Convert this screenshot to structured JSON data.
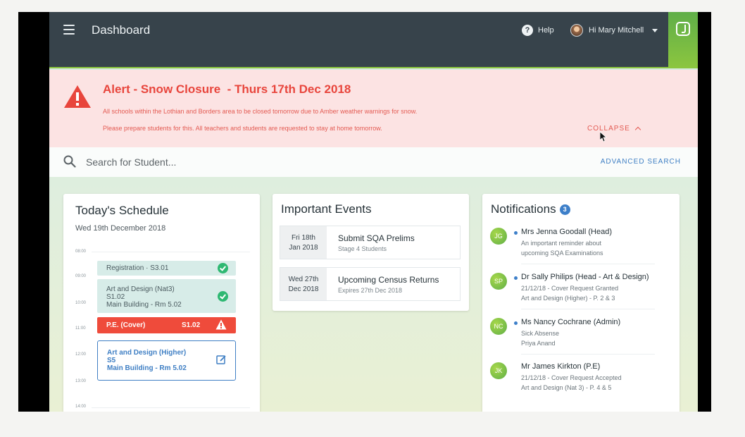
{
  "topbar": {
    "title": "Dashboard",
    "help_label": "Help",
    "user_label": "Hi Mary Mitchell"
  },
  "alert": {
    "title": "Alert - Snow Closure  - Thurs 17th Dec 2018",
    "line1": "All schools within the Lothian and Borders area to be closed tomorrow due to Amber weather warnings for snow.",
    "line2": "Please prepare students for this. All teachers and students are requested to stay at home tomorrow.",
    "collapse_label": "COLLAPSE"
  },
  "search": {
    "placeholder": "Search for Student...",
    "advanced_label": "ADVANCED SEARCH"
  },
  "schedule": {
    "title": "Today's Schedule",
    "date": "Wed 19th December 2018",
    "times": [
      "08:00",
      "09:00",
      "10:00",
      "11:00",
      "12:00",
      "13:00",
      "14:00"
    ],
    "slots": [
      {
        "line1": "Registration · S3.01",
        "status": "done"
      },
      {
        "line1": "Art and Design (Nat3)",
        "line2": "S1.02",
        "line3": "Main Building - Rm 5.02",
        "status": "done"
      },
      {
        "line1": "P.E. (Cover)",
        "room": "S1.02",
        "status": "alert"
      },
      {
        "line1": "Art and Design (Higher)",
        "line2": "S5",
        "line3": "Main Building - Rm 5.02",
        "status": "edit"
      }
    ]
  },
  "events": {
    "title": "Important Events",
    "items": [
      {
        "date1": "Fri 18th",
        "date2": "Jan 2018",
        "title": "Submit SQA Prelims",
        "sub": "Stage 4 Students"
      },
      {
        "date1": "Wed 27th",
        "date2": "Dec 2018",
        "title": "Upcoming Census Returns",
        "sub": "Expires 27th Dec 2018"
      }
    ]
  },
  "notifications": {
    "title": "Notifications",
    "count": "3",
    "items": [
      {
        "initials": "JG",
        "title": "Mrs Jenna Goodall (Head)",
        "line1": "An important reminder about",
        "line2": "upcoming SQA Examinations",
        "unread": true
      },
      {
        "initials": "SP",
        "title": "Dr Sally Philips (Head - Art & Design)",
        "line1": "21/12/18 - Cover Request Granted",
        "line2": "Art and Design (Higher) - P. 2 & 3",
        "unread": true
      },
      {
        "initials": "NC",
        "title": "Ms Nancy Cochrane (Admin)",
        "line1": "Sick Absense",
        "line2": "Priya Anand",
        "unread": true
      },
      {
        "initials": "JK",
        "title": "Mr James Kirkton (P.E)",
        "line1": "21/12/18 - Cover Request Accepted",
        "line2": "Art and Design (Nat 3) - P. 4 & 5",
        "unread": false
      }
    ]
  },
  "colors": {
    "topbar": "#37434b",
    "alert_bg": "#fce3e3",
    "alert_text": "#e8453c",
    "accent_blue": "#3f7fc4",
    "brand_green": "#8cc63f",
    "success": "#2eb872"
  }
}
